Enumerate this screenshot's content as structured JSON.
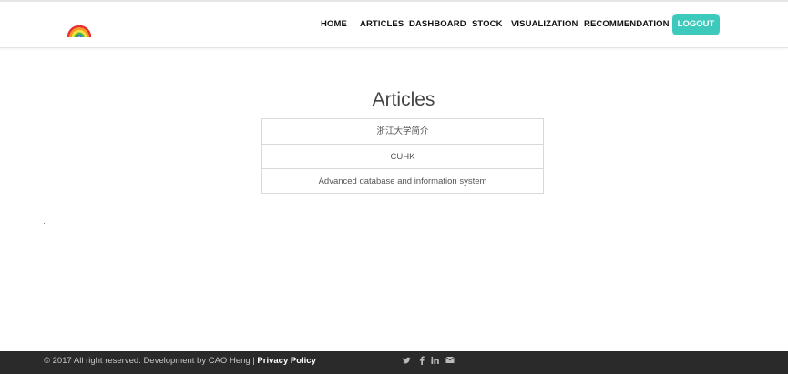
{
  "nav": {
    "home": "HOME",
    "articles": "ARTICLES",
    "dashboard": "DASHBOARD",
    "stock": "STOCK",
    "visualization": "VISUALIZATION",
    "recommendation": "RECOMMENDATION",
    "logout": "LOGOUT"
  },
  "main": {
    "title": "Articles",
    "articles": [
      "浙江大学简介",
      "CUHK",
      "Advanced database and information system"
    ]
  },
  "footer": {
    "copyright": "© 2017 All right reserved. Development by CAO Heng | ",
    "privacy": "Privacy Policy",
    "social_icons": [
      "twitter-icon",
      "facebook-icon",
      "linkedin-icon",
      "envelope-icon"
    ]
  },
  "colors": {
    "accent": "#3ec9bd",
    "footer_bg": "#2a2a2a"
  }
}
